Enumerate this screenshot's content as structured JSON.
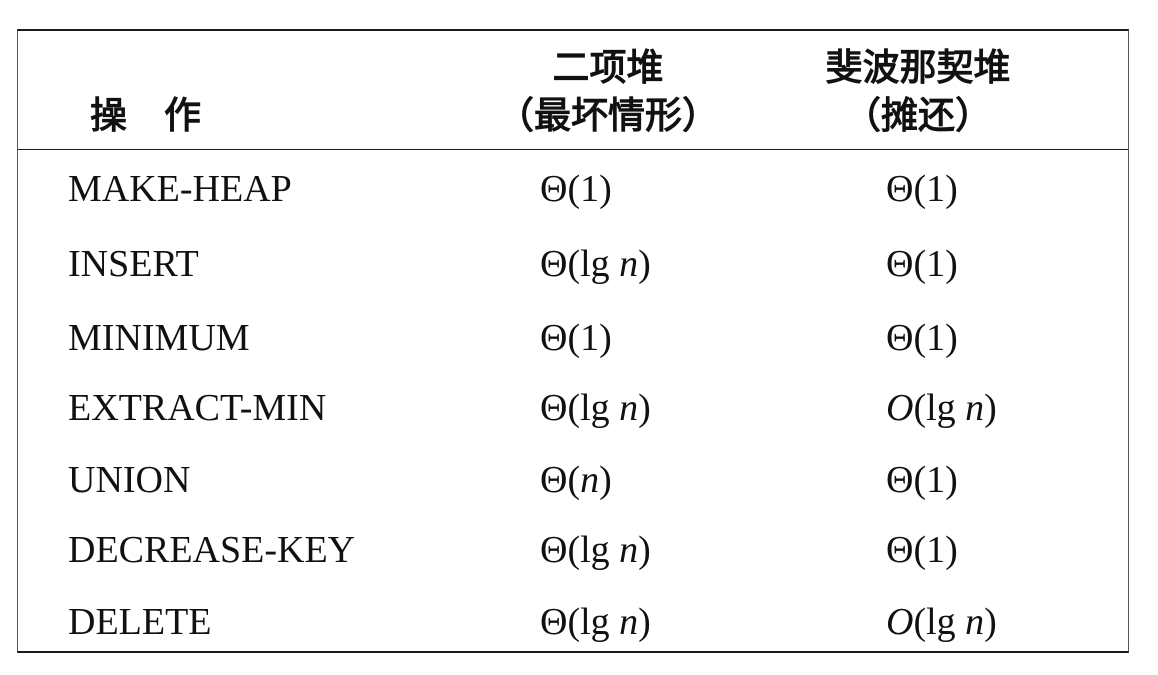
{
  "table": {
    "header": {
      "operation": "操　作",
      "binary_heap": {
        "line1": "二项堆",
        "line2": "（最坏情形）"
      },
      "fibonacci_heap": {
        "line1": "斐波那契堆",
        "line2": "（摊还）"
      }
    },
    "rows": [
      {
        "operation": "MAKE-HEAP",
        "binary": "Θ(1)",
        "fibonacci": "Θ(1)"
      },
      {
        "operation": "INSERT",
        "binary": "Θ(lg n)",
        "fibonacci": "Θ(1)"
      },
      {
        "operation": "MINIMUM",
        "binary": "Θ(1)",
        "fibonacci": "Θ(1)"
      },
      {
        "operation": "EXTRACT-MIN",
        "binary": "Θ(lg n)",
        "fibonacci": "O(lg n)"
      },
      {
        "operation": "UNION",
        "binary": "Θ(n)",
        "fibonacci": "Θ(1)"
      },
      {
        "operation": "DECREASE-KEY",
        "binary": "Θ(lg n)",
        "fibonacci": "Θ(1)"
      },
      {
        "operation": "DELETE",
        "binary": "Θ(lg n)",
        "fibonacci": "O(lg n)"
      }
    ]
  }
}
